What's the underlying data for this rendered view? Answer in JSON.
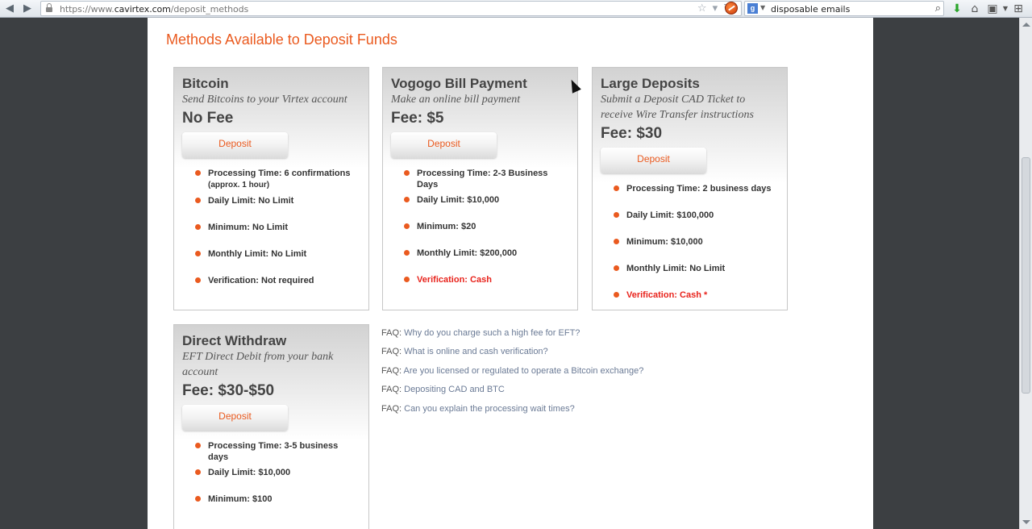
{
  "browser": {
    "url_prefix": "https://www.",
    "url_host": "cavirtex.com",
    "url_path": "/deposit_methods",
    "search_query": "disposable emails",
    "search_engine_label": "g"
  },
  "page": {
    "title": "Methods Available to Deposit Funds"
  },
  "cards": [
    {
      "title": "Bitcoin",
      "subtitle": "Send Bitcoins to your Virtex account",
      "fee": "No Fee",
      "button": "Deposit",
      "features": [
        {
          "text": "Processing Time: 6 confirmations",
          "sub": "(approx. 1 hour)"
        },
        {
          "text": "Daily Limit: No Limit"
        },
        {
          "text": "Minimum: No Limit"
        },
        {
          "text": "Monthly Limit: No Limit"
        },
        {
          "text": "Verification: Not required"
        }
      ]
    },
    {
      "title": "Vogogo Bill Payment",
      "subtitle": "Make an online bill payment",
      "fee": "Fee: $5",
      "button": "Deposit",
      "features": [
        {
          "text": "Processing Time: 2-3 Business Days"
        },
        {
          "text": "Daily Limit: $10,000"
        },
        {
          "text": "Minimum: $20"
        },
        {
          "text": "Monthly Limit: $200,000"
        },
        {
          "text": "Verification: Cash"
        }
      ]
    },
    {
      "title": "Large Deposits",
      "subtitle": "Submit a Deposit CAD Ticket to receive Wire Transfer instructions",
      "fee": "Fee: $30",
      "button": "Deposit",
      "features": [
        {
          "text": "Processing Time: 2 business days"
        },
        {
          "text": "Daily Limit: $100,000"
        },
        {
          "text": "Minimum: $10,000"
        },
        {
          "text": "Monthly Limit: No Limit"
        },
        {
          "text": "Verification: Cash *"
        }
      ]
    },
    {
      "title": "Direct Withdraw",
      "subtitle": "EFT Direct Debit from your bank account",
      "fee": "Fee: $30-$50",
      "button": "Deposit",
      "features": [
        {
          "text": "Processing Time: 3-5 business days"
        },
        {
          "text": "Daily Limit: $10,000"
        },
        {
          "text": "Minimum: $100"
        }
      ]
    }
  ],
  "faq": {
    "prefix": "FAQ:",
    "items": [
      "Why do you charge such a high fee for EFT?",
      "What is online and cash verification?",
      "Are you licensed or regulated to operate a Bitcoin exchange?",
      "Depositing CAD and BTC",
      "Can you explain the processing wait times?"
    ]
  },
  "colors": {
    "accent": "#ea5a1f",
    "alert": "#e8231c",
    "faq_link": "#6a7a95"
  }
}
